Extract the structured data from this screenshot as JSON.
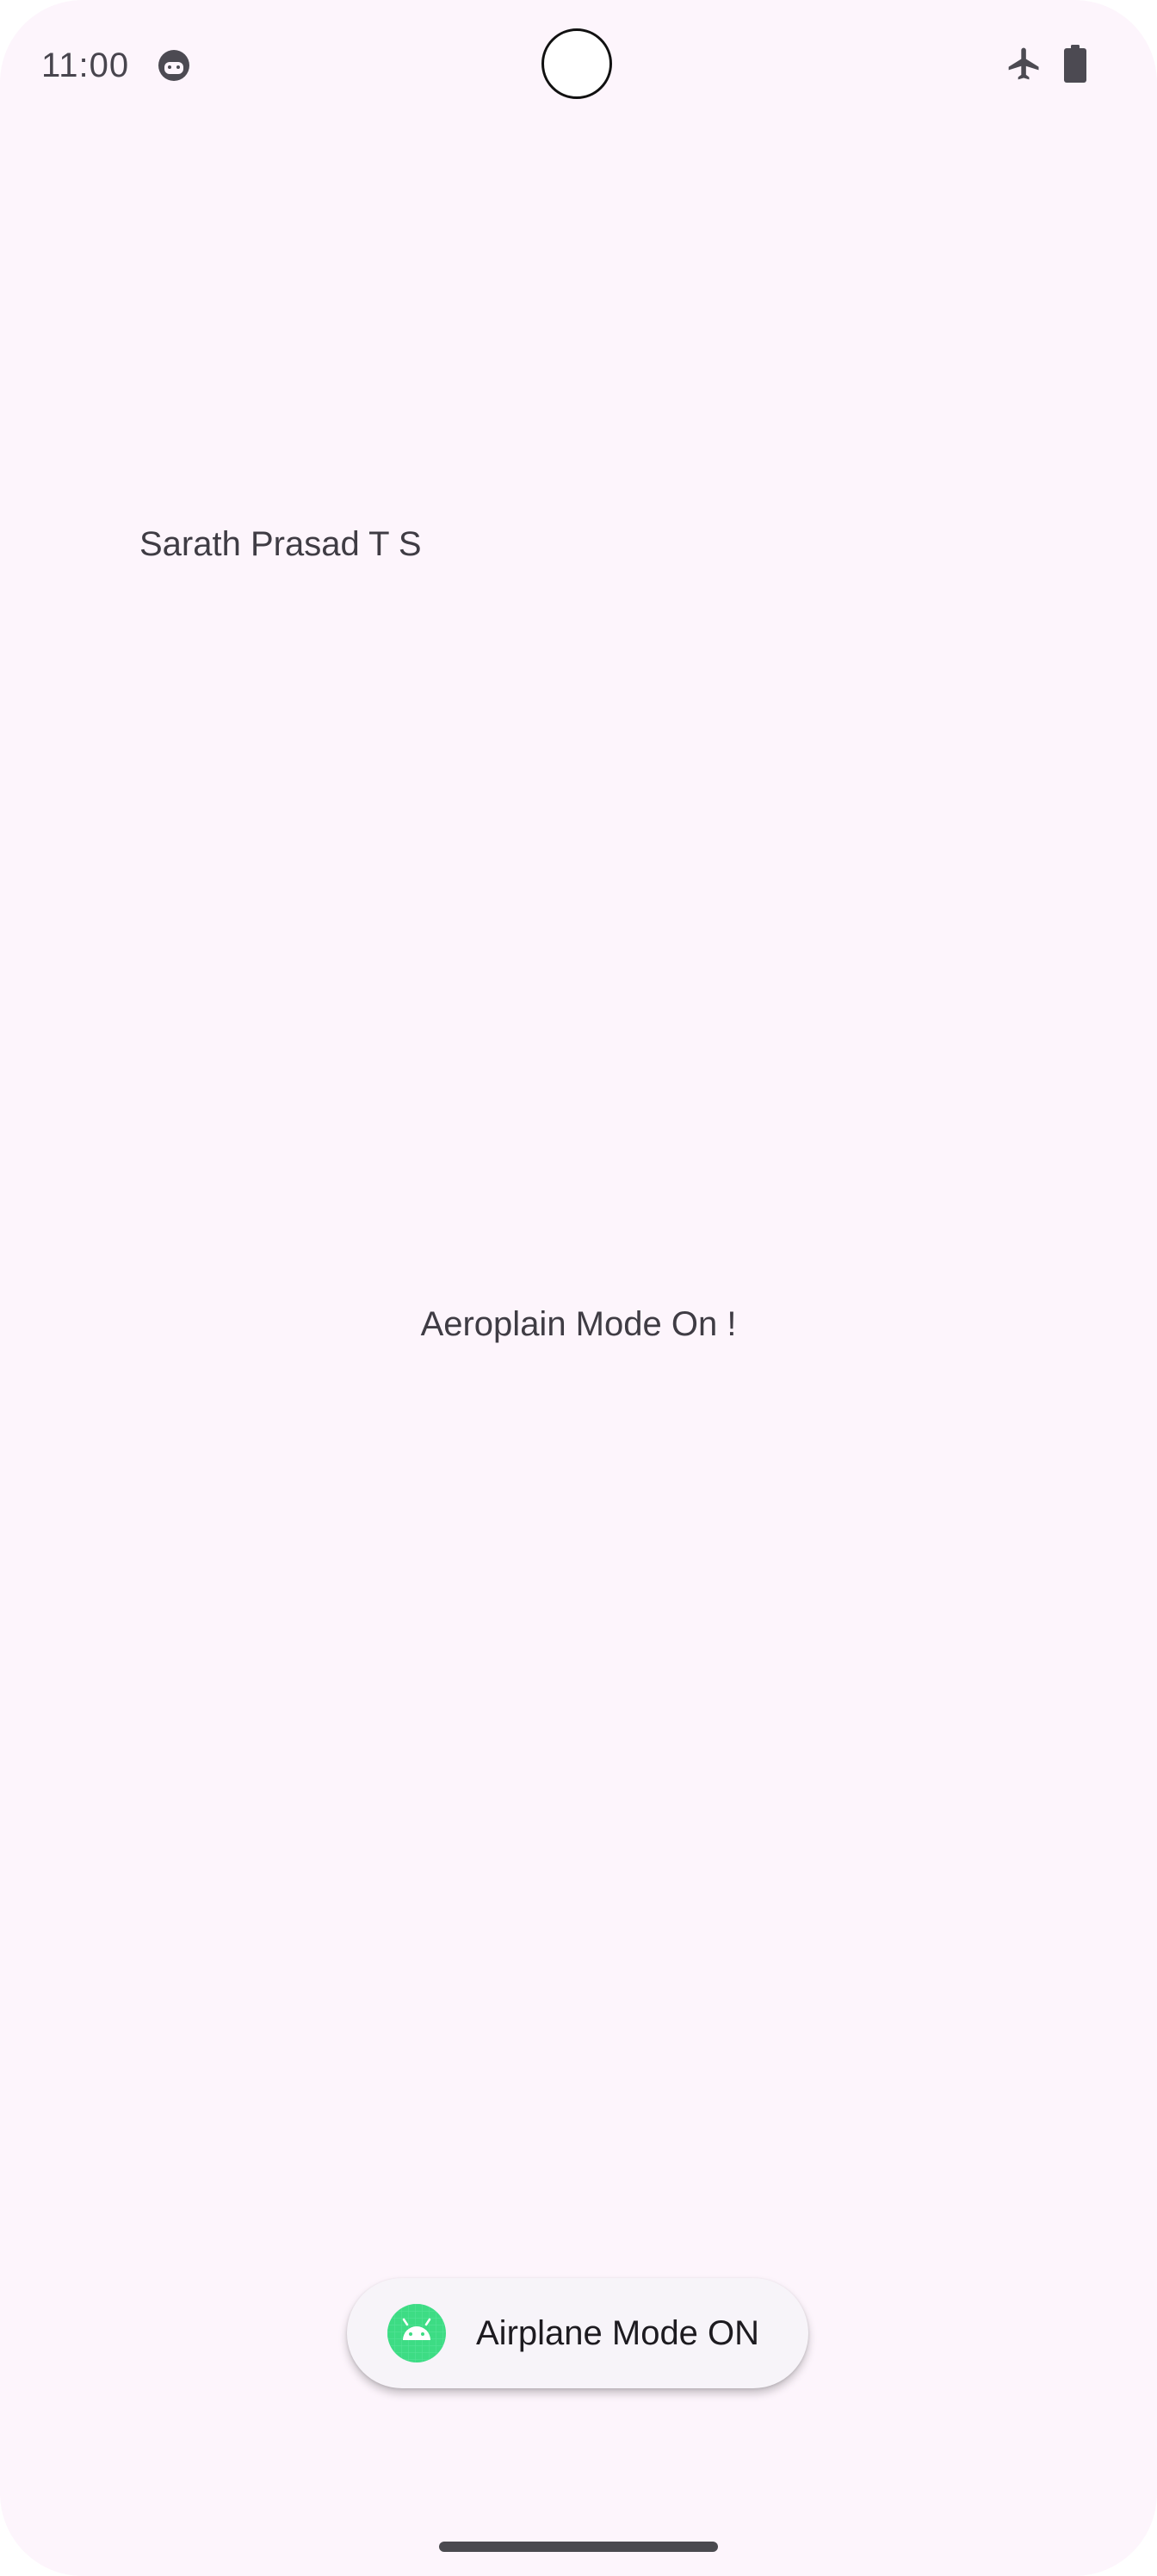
{
  "status_bar": {
    "time": "11:00",
    "app_icon": "face-icon",
    "icons": [
      "airplane-icon",
      "battery-full-icon"
    ]
  },
  "main": {
    "author_name": "Sarath Prasad T S",
    "message": "Aeroplain Mode On !"
  },
  "toast": {
    "icon": "android-icon",
    "text": "Airplane Mode ON"
  },
  "colors": {
    "background": "#fdf5fc",
    "text": "#3f3c44",
    "toast_background": "#f7f4f9",
    "android_green": "#3ddc84"
  }
}
